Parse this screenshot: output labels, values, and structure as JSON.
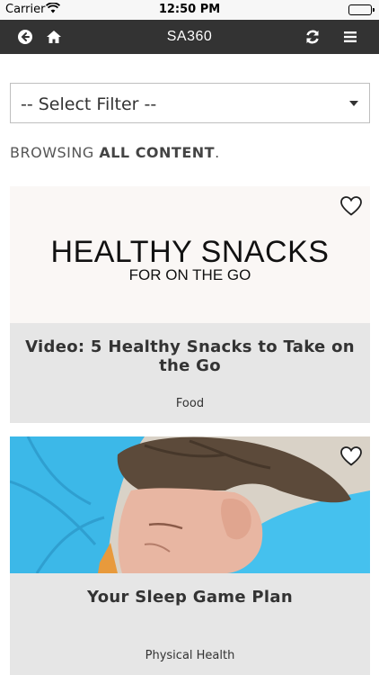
{
  "status_bar": {
    "carrier": "Carrier",
    "time": "12:50 PM"
  },
  "header": {
    "title": "SA360",
    "icons": [
      "back-arrow-icon",
      "home-icon",
      "refresh-icon",
      "hamburger-menu-icon"
    ]
  },
  "filter": {
    "selected": "-- Select Filter --"
  },
  "browse": {
    "prefix": "BROWSING ",
    "emphasis": "ALL CONTENT",
    "suffix": "."
  },
  "cards": [
    {
      "thumbnail_headline": "HEALTHY SNACKS",
      "thumbnail_subline": "FOR ON THE GO",
      "title": "Video: 5 Healthy Snacks to Take on the Go",
      "category": "Food"
    },
    {
      "title": "Your Sleep Game Plan",
      "category": "Physical Health"
    }
  ],
  "colors": {
    "header_bg": "#333333",
    "card_bg": "#e6e6e6",
    "pillow_blue": "#38b6e6"
  }
}
